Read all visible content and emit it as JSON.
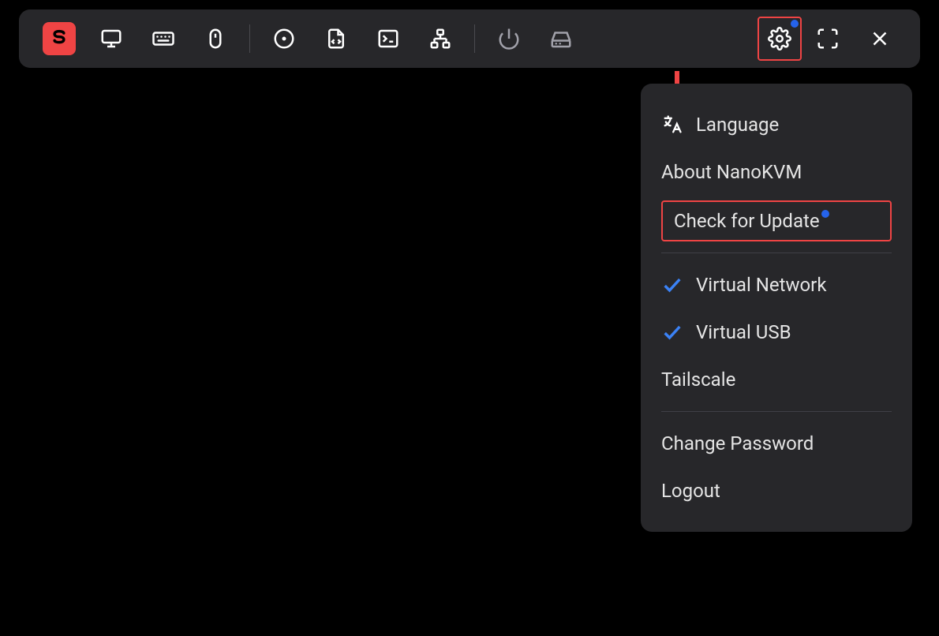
{
  "toolbar": {
    "logo_letter": "S"
  },
  "menu": {
    "language": "Language",
    "about": "About NanoKVM",
    "check_update": "Check for Update",
    "virtual_network": "Virtual Network",
    "virtual_usb": "Virtual USB",
    "tailscale": "Tailscale",
    "change_password": "Change Password",
    "logout": "Logout"
  }
}
